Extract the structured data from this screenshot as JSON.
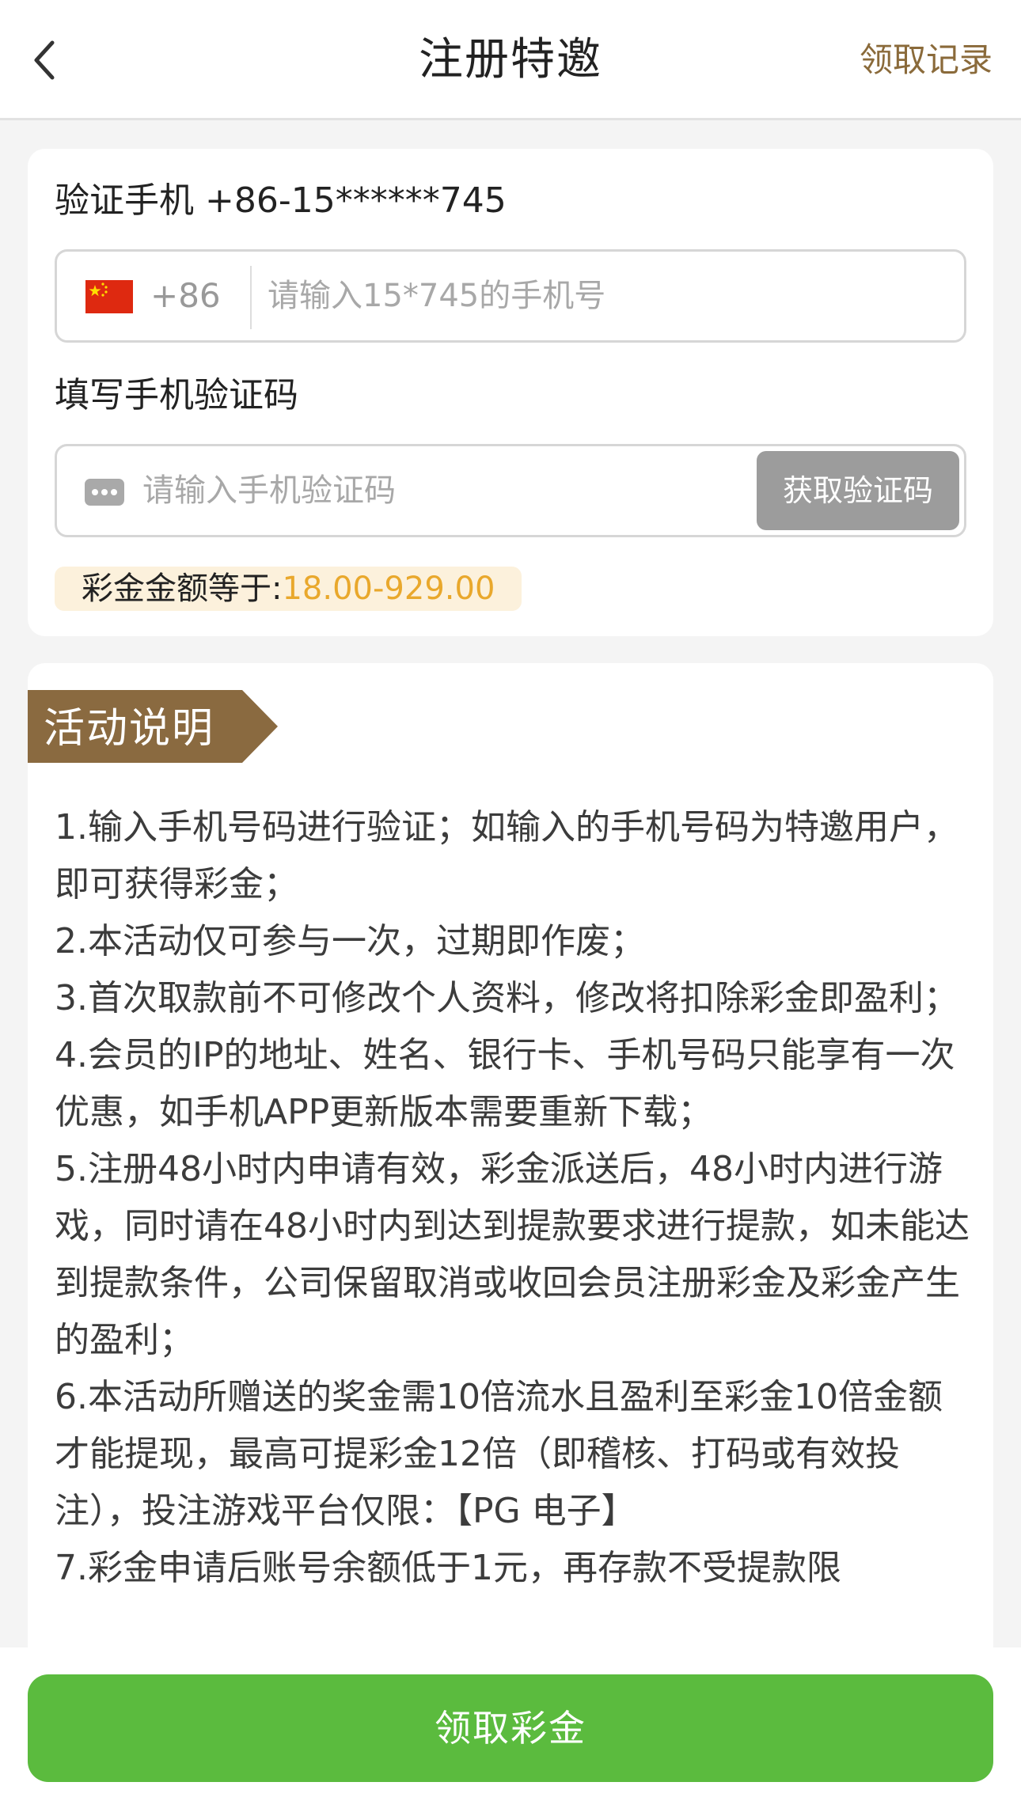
{
  "header": {
    "title": "注册特邀",
    "right_link": "领取记录"
  },
  "verify": {
    "phone_label": "验证手机 +86-15******745",
    "country_code": "+86",
    "phone_placeholder": "请输入15*745的手机号",
    "code_label": "填写手机验证码",
    "code_placeholder": "请输入手机验证码",
    "code_button": "获取验证码",
    "bonus_label": "彩金金额等于:",
    "bonus_value": "18.00-929.00"
  },
  "description": {
    "title": "活动说明",
    "items": [
      "1.输入手机号码进行验证；如输入的手机号码为特邀用户，即可获得彩金；",
      "2.本活动仅可参与一次，过期即作废；",
      "3.首次取款前不可修改个人资料，修改将扣除彩金即盈利；",
      "4.会员的IP的地址、姓名、银行卡、手机号码只能享有一次优惠，如手机APP更新版本需要重新下载；",
      "5.注册48小时内申请有效，彩金派送后，48小时内进行游戏，同时请在48小时内到达到提款要求进行提款，如未能达到提款条件，公司保留取消或收回会员注册彩金及彩金产生的盈利；",
      "6.本活动所赠送的奖金需10倍流水且盈利至彩金10倍金额才能提现，最高可提彩金12倍（即稽核、打码或有效投注），投注游戏平台仅限：【PG 电子】",
      "7.彩金申请后账号余额低于1元，再存款不受提款限"
    ]
  },
  "footer": {
    "claim_button": "领取彩金"
  },
  "colors": {
    "accent_gold": "#8a6a3a",
    "ribbon_brown": "#8a6a40",
    "bonus_orange": "#e9a82c",
    "claim_green": "#5bbb3e",
    "disabled_gray": "#9c9c9c"
  },
  "icons": {
    "back": "chevron-left-icon",
    "flag": "china-flag-icon",
    "sms": "message-dots-icon"
  }
}
